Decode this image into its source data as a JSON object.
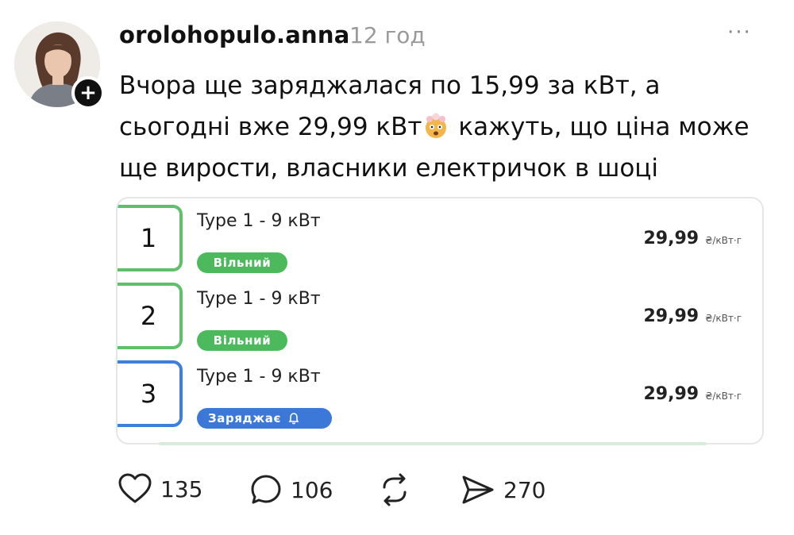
{
  "post": {
    "username": "orolohopulo.anna",
    "time": "12 год",
    "more": "···",
    "text_line1": "Вчора ще заряджалася по 15,99 за кВт, а",
    "text_line2_part1": "сьогодні вже 29,99 кВт",
    "text_line2_part2": " кажуть, що ціна може",
    "text_line3": "ще вирости, власники електричок в шоці",
    "emoji": "exploding-head-emoji",
    "follow_symbol": "+"
  },
  "chargers": [
    {
      "number": "1",
      "connector": "Type 1 - 9 кВт",
      "status": "Вільний",
      "status_color": "#4cba5c",
      "price": "29,99",
      "unit": "₴/кВт·г"
    },
    {
      "number": "2",
      "connector": "Type 1 - 9 кВт",
      "status": "Вільний",
      "status_color": "#4cba5c",
      "price": "29,99",
      "unit": "₴/кВт·г"
    },
    {
      "number": "3",
      "connector": "Type 1 - 9 кВт",
      "status": "Заряджає",
      "status_color": "#3b78d8",
      "price": "29,99",
      "unit": "₴/кВт·г"
    }
  ],
  "actions": {
    "likes": "135",
    "comments": "106",
    "shares": "270"
  },
  "icons": [
    "heart-icon",
    "comment-icon",
    "repost-icon",
    "send-icon",
    "bell-icon",
    "plus-icon",
    "more-icon"
  ]
}
